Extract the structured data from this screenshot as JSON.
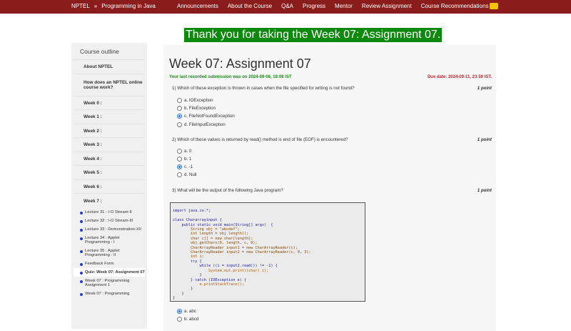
{
  "topbar": {
    "brand": "NPTEL",
    "separator": "»",
    "course": "Programming in Java",
    "nav": [
      "Announcements",
      "About the Course",
      "Q&A",
      "Progress",
      "Mentor",
      "Review Assignment",
      "Course Recommendations"
    ]
  },
  "banner": "Thank you for taking the Week 07: Assignment 07.",
  "sidebar": {
    "title": "Course outline",
    "items": [
      {
        "label": "About NPTEL"
      },
      {
        "label": "How does an NPTEL online course work?"
      },
      {
        "label": "Week 0 :"
      },
      {
        "label": "Week 1 :"
      },
      {
        "label": "Week 2 :"
      },
      {
        "label": "Week 3 :"
      },
      {
        "label": "Week 4 :"
      },
      {
        "label": "Week 5 :"
      },
      {
        "label": "Week 6 :"
      },
      {
        "label": "Week 7 :"
      }
    ],
    "subitems": [
      {
        "label": "Lecture 31 : I-O Stream-II"
      },
      {
        "label": "Lecture 32 : I-O Stream-III"
      },
      {
        "label": "Lecture 33 : Demonstration-XII"
      },
      {
        "label": "Lecture 34 : Applet Programming - I"
      },
      {
        "label": "Lecture 35 : Applet Programming - II"
      },
      {
        "label": "Feedback Form"
      },
      {
        "label": "Quiz: Week 07: Assignment 07"
      },
      {
        "label": "Week 07 : Programming Assignment 1"
      },
      {
        "label": "Week 07 : Programming"
      }
    ]
  },
  "main": {
    "title": "Week 07: Assignment 07",
    "submission": "Your last recorded submission was on 2024-09-06, 18:08 IST",
    "due": "Due date: 2024-09-11, 23:59 IST.",
    "questions": [
      {
        "text": "1)   Which of these exception is thrown in cases when the file specified for writing is not found?",
        "points": "1 point",
        "options": [
          {
            "label": "a. IOException",
            "selected": false
          },
          {
            "label": "b. FileException",
            "selected": false
          },
          {
            "label": "c. FileNotFoundException",
            "selected": true
          },
          {
            "label": "d. FileInputException",
            "selected": false
          }
        ]
      },
      {
        "text": "2)   Which of these values is returned by read() method is end of file (EOF) is encountered?",
        "points": "1 point",
        "options": [
          {
            "label": "a. 0",
            "selected": false
          },
          {
            "label": "b. 1",
            "selected": false
          },
          {
            "label": "c. -1",
            "selected": true
          },
          {
            "label": "d. Null",
            "selected": false
          }
        ]
      },
      {
        "text": "3)   What will be the output of the following Java program?",
        "points": "1 point",
        "options": [
          {
            "label": "a. abc",
            "selected": true
          },
          {
            "label": "b. abcd",
            "selected": false
          }
        ]
      }
    ],
    "code_lines": [
      "import java.io.*;",
      "",
      "class Chararrayinput {",
      "    public static void main(String[] args)  {",
      "        String obj = \"abcdef\";",
      "        int length = obj.length();",
      "        char c[] = new char[length];",
      "        obj.getChars(0, length, c, 0);",
      "        CharArrayReader input1 = new CharArrayReader(c);",
      "        CharArrayReader input2 = new CharArrayReader(c, 0, 3);",
      "        int i;",
      "        try {",
      "            while ((i = input2.read()) != -1) {",
      "                System.out.print((char) i);",
      "            }",
      "        } catch (IOException e) {",
      "            e.printStackTrace();",
      "        }",
      "    }",
      "}"
    ]
  },
  "colors": {
    "topbar": "#8a1c1c",
    "banner": "#0d8a0d",
    "submission": "#1b8a1b",
    "due": "#c0262c",
    "radio_selected": "#2a6fdb"
  }
}
